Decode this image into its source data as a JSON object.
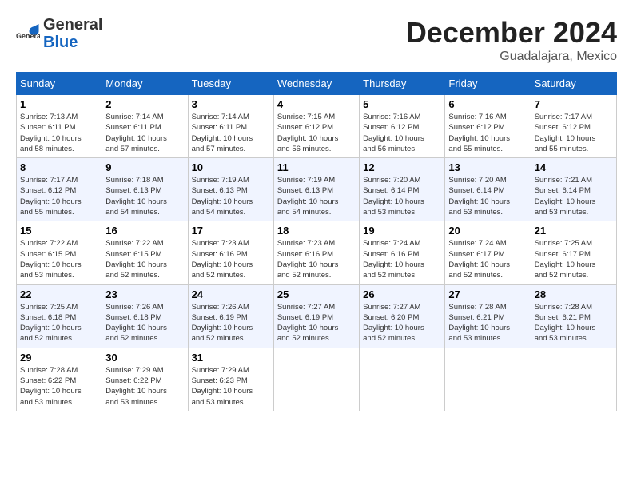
{
  "logo": {
    "general": "General",
    "blue": "Blue"
  },
  "title": "December 2024",
  "location": "Guadalajara, Mexico",
  "days_of_week": [
    "Sunday",
    "Monday",
    "Tuesday",
    "Wednesday",
    "Thursday",
    "Friday",
    "Saturday"
  ],
  "weeks": [
    [
      {
        "day": "1",
        "info": "Sunrise: 7:13 AM\nSunset: 6:11 PM\nDaylight: 10 hours\nand 58 minutes."
      },
      {
        "day": "2",
        "info": "Sunrise: 7:14 AM\nSunset: 6:11 PM\nDaylight: 10 hours\nand 57 minutes."
      },
      {
        "day": "3",
        "info": "Sunrise: 7:14 AM\nSunset: 6:11 PM\nDaylight: 10 hours\nand 57 minutes."
      },
      {
        "day": "4",
        "info": "Sunrise: 7:15 AM\nSunset: 6:12 PM\nDaylight: 10 hours\nand 56 minutes."
      },
      {
        "day": "5",
        "info": "Sunrise: 7:16 AM\nSunset: 6:12 PM\nDaylight: 10 hours\nand 56 minutes."
      },
      {
        "day": "6",
        "info": "Sunrise: 7:16 AM\nSunset: 6:12 PM\nDaylight: 10 hours\nand 55 minutes."
      },
      {
        "day": "7",
        "info": "Sunrise: 7:17 AM\nSunset: 6:12 PM\nDaylight: 10 hours\nand 55 minutes."
      }
    ],
    [
      {
        "day": "8",
        "info": "Sunrise: 7:17 AM\nSunset: 6:12 PM\nDaylight: 10 hours\nand 55 minutes."
      },
      {
        "day": "9",
        "info": "Sunrise: 7:18 AM\nSunset: 6:13 PM\nDaylight: 10 hours\nand 54 minutes."
      },
      {
        "day": "10",
        "info": "Sunrise: 7:19 AM\nSunset: 6:13 PM\nDaylight: 10 hours\nand 54 minutes."
      },
      {
        "day": "11",
        "info": "Sunrise: 7:19 AM\nSunset: 6:13 PM\nDaylight: 10 hours\nand 54 minutes."
      },
      {
        "day": "12",
        "info": "Sunrise: 7:20 AM\nSunset: 6:14 PM\nDaylight: 10 hours\nand 53 minutes."
      },
      {
        "day": "13",
        "info": "Sunrise: 7:20 AM\nSunset: 6:14 PM\nDaylight: 10 hours\nand 53 minutes."
      },
      {
        "day": "14",
        "info": "Sunrise: 7:21 AM\nSunset: 6:14 PM\nDaylight: 10 hours\nand 53 minutes."
      }
    ],
    [
      {
        "day": "15",
        "info": "Sunrise: 7:22 AM\nSunset: 6:15 PM\nDaylight: 10 hours\nand 53 minutes."
      },
      {
        "day": "16",
        "info": "Sunrise: 7:22 AM\nSunset: 6:15 PM\nDaylight: 10 hours\nand 52 minutes."
      },
      {
        "day": "17",
        "info": "Sunrise: 7:23 AM\nSunset: 6:16 PM\nDaylight: 10 hours\nand 52 minutes."
      },
      {
        "day": "18",
        "info": "Sunrise: 7:23 AM\nSunset: 6:16 PM\nDaylight: 10 hours\nand 52 minutes."
      },
      {
        "day": "19",
        "info": "Sunrise: 7:24 AM\nSunset: 6:16 PM\nDaylight: 10 hours\nand 52 minutes."
      },
      {
        "day": "20",
        "info": "Sunrise: 7:24 AM\nSunset: 6:17 PM\nDaylight: 10 hours\nand 52 minutes."
      },
      {
        "day": "21",
        "info": "Sunrise: 7:25 AM\nSunset: 6:17 PM\nDaylight: 10 hours\nand 52 minutes."
      }
    ],
    [
      {
        "day": "22",
        "info": "Sunrise: 7:25 AM\nSunset: 6:18 PM\nDaylight: 10 hours\nand 52 minutes."
      },
      {
        "day": "23",
        "info": "Sunrise: 7:26 AM\nSunset: 6:18 PM\nDaylight: 10 hours\nand 52 minutes."
      },
      {
        "day": "24",
        "info": "Sunrise: 7:26 AM\nSunset: 6:19 PM\nDaylight: 10 hours\nand 52 minutes."
      },
      {
        "day": "25",
        "info": "Sunrise: 7:27 AM\nSunset: 6:19 PM\nDaylight: 10 hours\nand 52 minutes."
      },
      {
        "day": "26",
        "info": "Sunrise: 7:27 AM\nSunset: 6:20 PM\nDaylight: 10 hours\nand 52 minutes."
      },
      {
        "day": "27",
        "info": "Sunrise: 7:28 AM\nSunset: 6:21 PM\nDaylight: 10 hours\nand 53 minutes."
      },
      {
        "day": "28",
        "info": "Sunrise: 7:28 AM\nSunset: 6:21 PM\nDaylight: 10 hours\nand 53 minutes."
      }
    ],
    [
      {
        "day": "29",
        "info": "Sunrise: 7:28 AM\nSunset: 6:22 PM\nDaylight: 10 hours\nand 53 minutes."
      },
      {
        "day": "30",
        "info": "Sunrise: 7:29 AM\nSunset: 6:22 PM\nDaylight: 10 hours\nand 53 minutes."
      },
      {
        "day": "31",
        "info": "Sunrise: 7:29 AM\nSunset: 6:23 PM\nDaylight: 10 hours\nand 53 minutes."
      },
      {
        "day": "",
        "info": ""
      },
      {
        "day": "",
        "info": ""
      },
      {
        "day": "",
        "info": ""
      },
      {
        "day": "",
        "info": ""
      }
    ]
  ]
}
